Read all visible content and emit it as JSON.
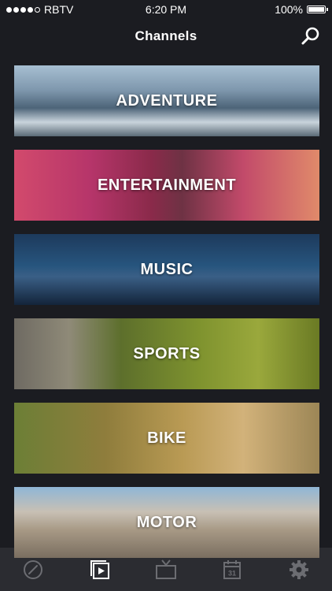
{
  "status_bar": {
    "carrier": "RBTV",
    "time": "6:20 PM",
    "battery_percent": "100%",
    "battery_level": 1.0,
    "signal_bars": 4,
    "signal_max": 5
  },
  "header": {
    "title": "Channels",
    "search_icon": "search-icon"
  },
  "channels": [
    {
      "label": "ADVENTURE",
      "accent": "#6f8fa8"
    },
    {
      "label": "ENTERTAINMENT",
      "accent": "#c24a78"
    },
    {
      "label": "MUSIC",
      "accent": "#2f5f8a"
    },
    {
      "label": "SPORTS",
      "accent": "#7c8a3a"
    },
    {
      "label": "BIKE",
      "accent": "#a8873c"
    },
    {
      "label": "MOTOR",
      "accent": "#a8a092"
    }
  ],
  "tab_bar": {
    "active_color": "#ffffff",
    "inactive_color": "#6c6d72",
    "tabs": [
      {
        "icon": "compass-icon",
        "active": false
      },
      {
        "icon": "channels-play-icon",
        "active": true
      },
      {
        "icon": "tv-icon",
        "active": false
      },
      {
        "icon": "calendar-icon",
        "active": false,
        "day": "31"
      },
      {
        "icon": "gear-icon",
        "active": false
      }
    ]
  }
}
